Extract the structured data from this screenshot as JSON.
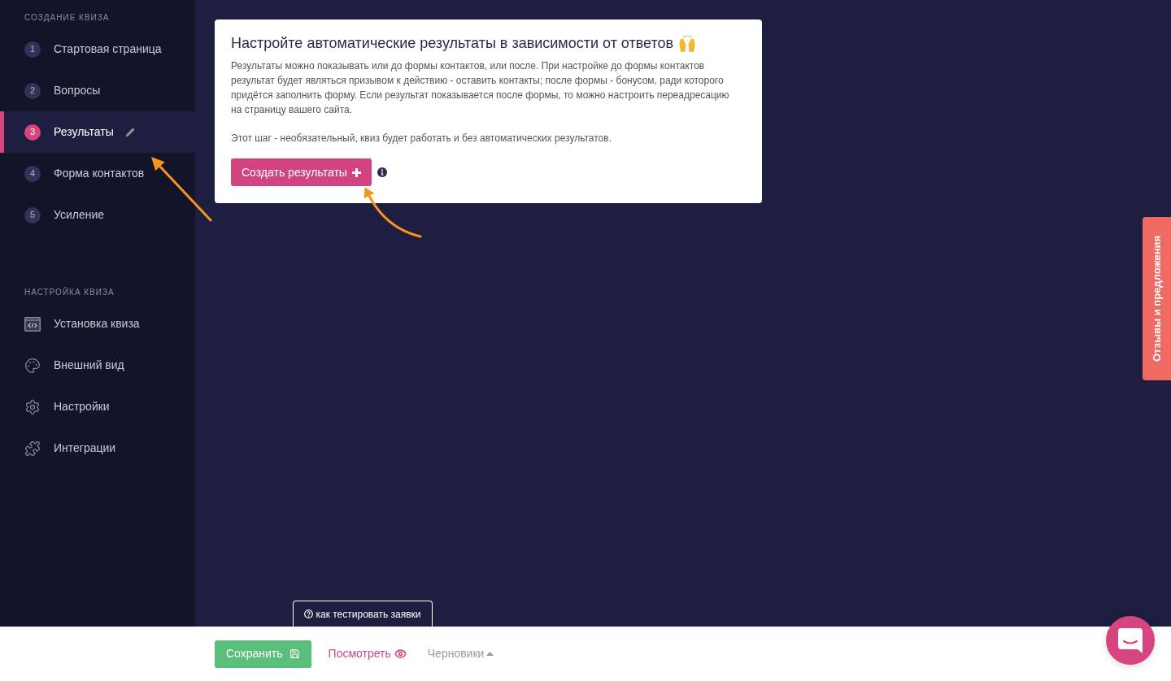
{
  "sidebar": {
    "sections": [
      {
        "title": "СОЗДАНИЕ КВИЗА",
        "items": [
          {
            "number": "1",
            "label": "Стартовая страница",
            "selected": false
          },
          {
            "number": "2",
            "label": "Вопросы",
            "selected": false
          },
          {
            "number": "3",
            "label": "Результаты",
            "selected": true
          },
          {
            "number": "4",
            "label": "Форма контактов",
            "selected": false
          },
          {
            "number": "5",
            "label": "Усиление",
            "selected": false
          }
        ]
      },
      {
        "title": "НАСТРОЙКА КВИЗА",
        "items": [
          {
            "label": "Установка квиза",
            "selected": false
          },
          {
            "label": "Внешний вид",
            "selected": false
          },
          {
            "label": "Настройки",
            "selected": false
          },
          {
            "label": "Интеграции",
            "selected": false
          }
        ]
      }
    ]
  },
  "card": {
    "title": "Настройте автоматические результаты в зависимости от ответов",
    "paragraphs": [
      "Результаты можно показывать или до формы контактов, или после. При настройке до формы контактов результат будет являться призывом к действию - оставить контакты; после формы - бонусом, ради которого придётся заполнить форму. Если результат показывается после формы, то можно настроить переадресацию на страницу вашего сайта.",
      "Этот шаг - необязательный, квиз будет работать и без автоматических результатов."
    ],
    "create_button": "Создать результаты"
  },
  "help_tab": "как тестировать заявки",
  "bottom_bar": {
    "save_button": "Сохранить",
    "preview_link": "Посмотреть",
    "drafts_menu": "Черновики"
  },
  "feedback_tab": "Отзывы и предложения"
}
